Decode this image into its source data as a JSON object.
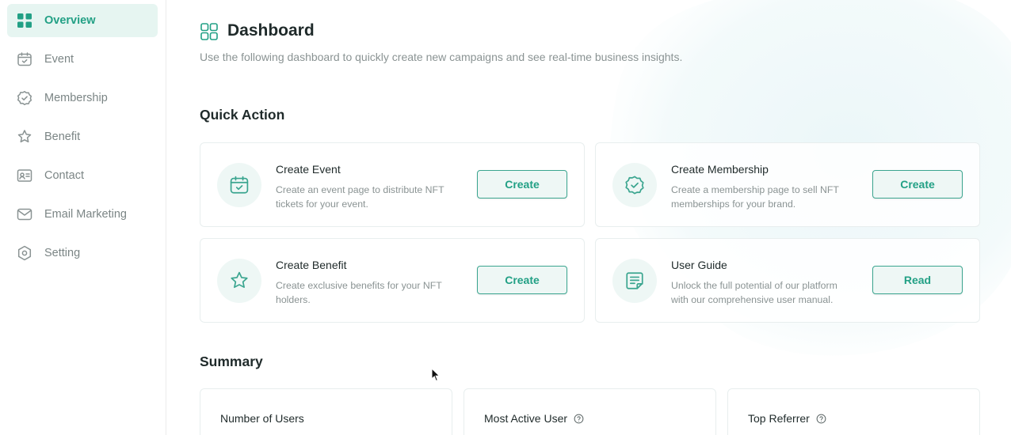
{
  "sidebar": {
    "items": [
      {
        "label": "Overview",
        "icon": "grid-icon",
        "active": true
      },
      {
        "label": "Event",
        "icon": "calendar-icon",
        "active": false
      },
      {
        "label": "Membership",
        "icon": "badge-check-icon",
        "active": false
      },
      {
        "label": "Benefit",
        "icon": "star-icon",
        "active": false
      },
      {
        "label": "Contact",
        "icon": "contact-card-icon",
        "active": false
      },
      {
        "label": "Email Marketing",
        "icon": "mail-icon",
        "active": false
      },
      {
        "label": "Setting",
        "icon": "settings-hexagon-icon",
        "active": false
      }
    ]
  },
  "header": {
    "title": "Dashboard",
    "subtitle": "Use the following dashboard to quickly create new campaigns and see real-time business insights."
  },
  "quick_action": {
    "title": "Quick Action",
    "cards": [
      {
        "title": "Create Event",
        "description": "Create an event page to distribute NFT tickets for your event.",
        "button": "Create",
        "icon": "calendar-icon"
      },
      {
        "title": "Create Membership",
        "description": "Create a membership page to sell NFT memberships for your brand.",
        "button": "Create",
        "icon": "badge-check-icon"
      },
      {
        "title": "Create Benefit",
        "description": "Create exclusive benefits for your NFT holders.",
        "button": "Create",
        "icon": "star-icon"
      },
      {
        "title": "User Guide",
        "description": "Unlock the full potential of our platform with our comprehensive user manual.",
        "button": "Read",
        "icon": "document-icon"
      }
    ]
  },
  "summary": {
    "title": "Summary",
    "cards": [
      {
        "label": "Number of Users",
        "has_help": false
      },
      {
        "label": "Most Active User",
        "has_help": true
      },
      {
        "label": "Top Referrer",
        "has_help": true
      }
    ]
  },
  "colors": {
    "accent": "#22a085",
    "accent_light": "#e6f5f1",
    "muted_text": "#8a9393"
  }
}
